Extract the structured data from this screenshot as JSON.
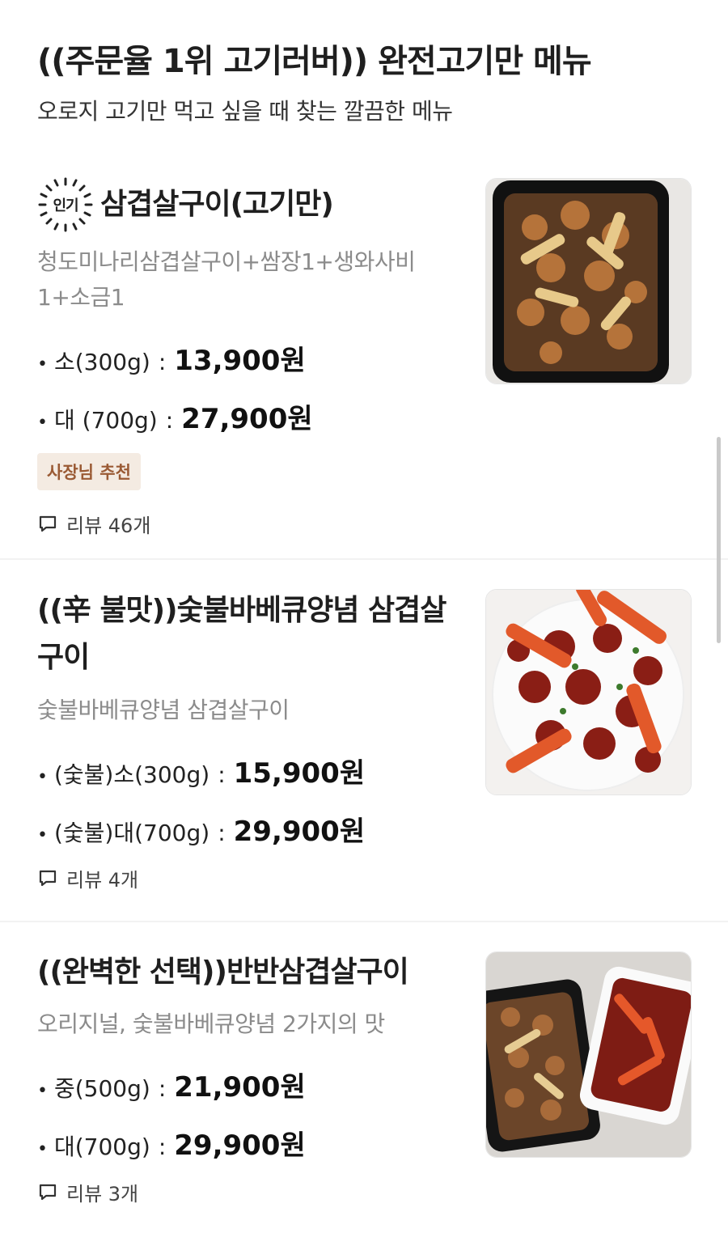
{
  "section": {
    "title": "((주문율 1위 고기러버)) 완전고기만 메뉴",
    "subtitle": "오로지 고기만 먹고 싶을 때 찾는 깔끔한 메뉴"
  },
  "items": [
    {
      "popular_label": "인기",
      "name": "삼겹살구이(고기만)",
      "description": "청도미나리삼겹살구이+쌈장1+생와사비1+소금1",
      "prices": [
        {
          "size": "소(300g)",
          "amount": "13,900원"
        },
        {
          "size": "대 (700g)",
          "amount": "27,900원"
        }
      ],
      "badge": "사장님 추천",
      "review": "리뷰 46개",
      "image_icon": "grilled-pork-belly-photo"
    },
    {
      "name": "((辛 불맛))숯불바베큐양념 삼겹살구이",
      "description": "숯불바베큐양념 삼겹살구이",
      "prices": [
        {
          "size": "(숯불)소(300g)",
          "amount": "15,900원"
        },
        {
          "size": "(숯불)대(700g)",
          "amount": "29,900원"
        }
      ],
      "review": "리뷰 4개",
      "image_icon": "spicy-bbq-pork-photo"
    },
    {
      "name": "((완벽한 선택))반반삼겹살구이",
      "description": "오리지널, 숯불바베큐양념 2가지의 맛",
      "prices": [
        {
          "size": "중(500g)",
          "amount": "21,900원"
        },
        {
          "size": "대(700g)",
          "amount": "29,900원"
        }
      ],
      "review": "리뷰 3개",
      "image_icon": "half-half-pork-photo"
    }
  ],
  "colors": {
    "badge_bg": "#f4ebe2",
    "badge_text": "#9a5a34",
    "description": "#8b8b8b"
  },
  "separator": ":",
  "bullet": "•"
}
